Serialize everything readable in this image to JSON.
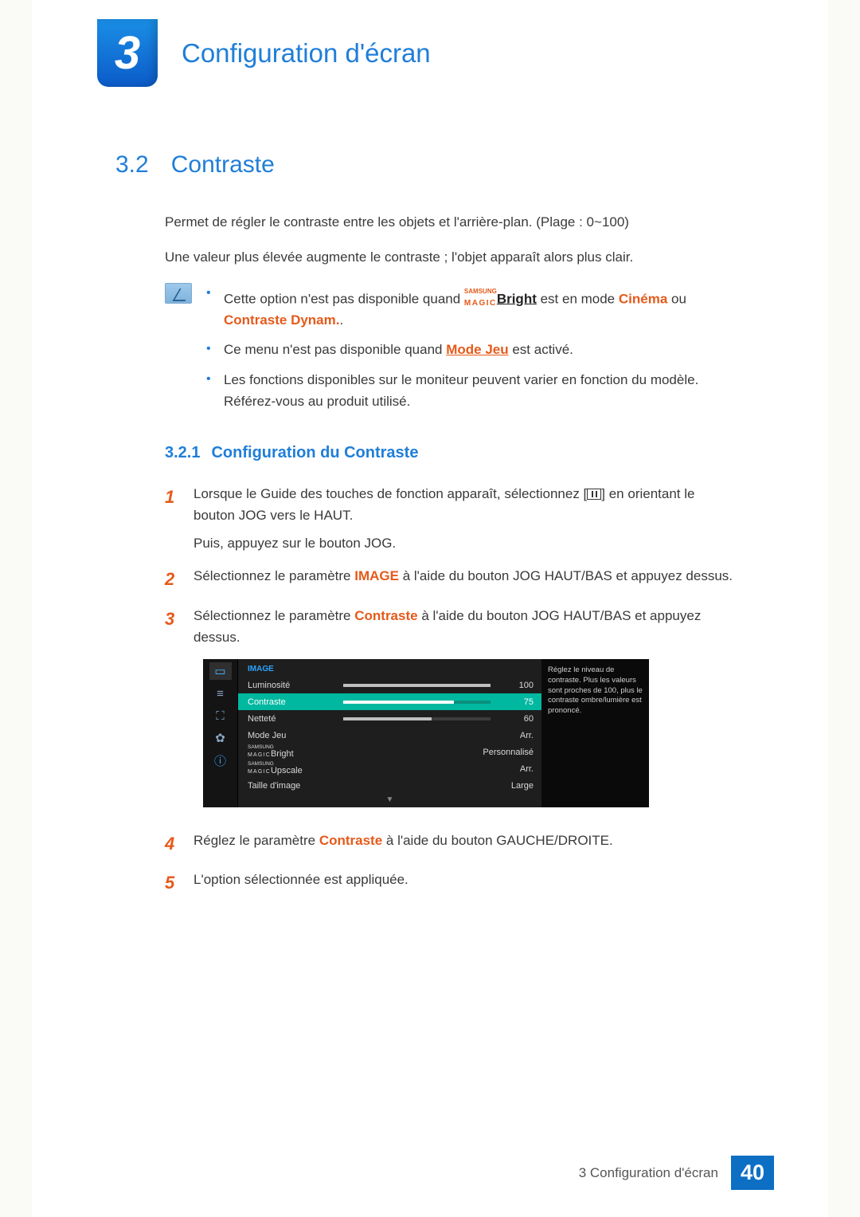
{
  "chapter": {
    "number": "3",
    "title": "Configuration d'écran"
  },
  "section": {
    "num": "3.2",
    "title": "Contraste",
    "intro1": "Permet de régler le contraste entre les objets et l'arrière-plan. (Plage : 0~100)",
    "intro2": "Une valeur plus élevée augmente le contraste ; l'objet apparaît alors plus clair."
  },
  "note": {
    "li1_a": "Cette option n'est pas disponible quand ",
    "samsung": "SAMSUNG",
    "magic": "MAGIC",
    "bright": "Bright",
    "li1_b": " est en mode ",
    "cinema": "Cinéma",
    "or": " ou ",
    "dynam": "Contraste Dynam.",
    "dot": ".",
    "li2_a": "Ce menu n'est pas disponible quand ",
    "mode_jeu": "Mode Jeu",
    "li2_b": " est activé.",
    "li3": "Les fonctions disponibles sur le moniteur peuvent varier en fonction du modèle. Référez-vous au produit utilisé."
  },
  "subsection": {
    "num": "3.2.1",
    "title": "Configuration du Contraste"
  },
  "steps": {
    "s1a": "Lorsque le Guide des touches de fonction apparaît, sélectionnez [",
    "s1b": "] en orientant le bouton JOG vers le HAUT.",
    "s1c": "Puis, appuyez sur le bouton JOG.",
    "s2a": "Sélectionnez le paramètre ",
    "image": "IMAGE",
    "s2b": " à l'aide du bouton JOG HAUT/BAS et appuyez dessus.",
    "s3a": "Sélectionnez le paramètre ",
    "contraste": "Contraste",
    "s3b": " à l'aide du bouton JOG HAUT/BAS et appuyez dessus.",
    "s4a": "Réglez le paramètre ",
    "s4b": " à l'aide du bouton GAUCHE/DROITE.",
    "s5": "L'option sélectionnée est appliquée."
  },
  "osd": {
    "title": "IMAGE",
    "rows": {
      "lum": {
        "label": "Luminosité",
        "val": "100",
        "pct": 100
      },
      "con": {
        "label": "Contraste",
        "val": "75",
        "pct": 75
      },
      "net": {
        "label": "Netteté",
        "val": "60",
        "pct": 60
      },
      "jeu": {
        "label": "Mode Jeu",
        "val": "Arr."
      },
      "mb": {
        "sams": "SAMSUNG",
        "magic": "MAGIC",
        "suffix": "Bright",
        "val": "Personnalisé"
      },
      "mu": {
        "sams": "SAMSUNG",
        "magic": "MAGIC",
        "suffix": "Upscale",
        "val": "Arr."
      },
      "ti": {
        "label": "Taille d'image",
        "val": "Large"
      }
    },
    "help": "Réglez le niveau de contraste. Plus les valeurs sont proches de 100, plus le contraste ombre/lumière est prononcé."
  },
  "footer": {
    "text": "3 Configuration d'écran",
    "page": "40"
  },
  "nums": {
    "n1": "1",
    "n2": "2",
    "n3": "3",
    "n4": "4",
    "n5": "5"
  }
}
